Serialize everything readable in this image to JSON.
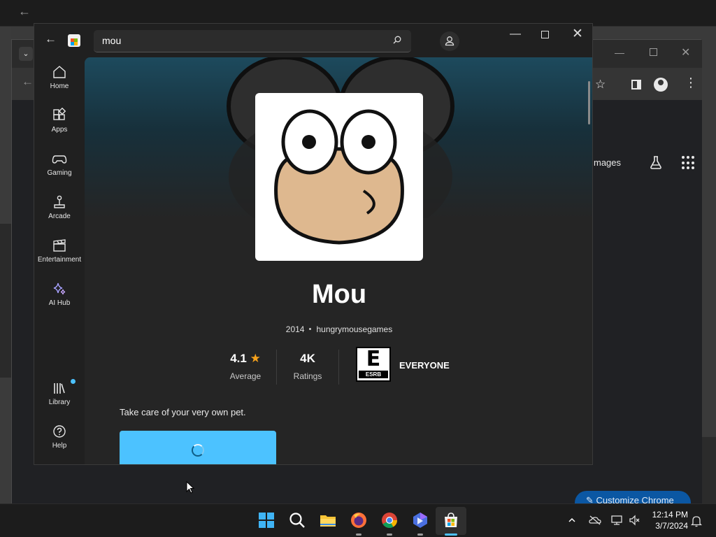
{
  "store": {
    "search": {
      "value": "mou"
    },
    "nav": [
      {
        "label": "Home"
      },
      {
        "label": "Apps"
      },
      {
        "label": "Gaming"
      },
      {
        "label": "Arcade"
      },
      {
        "label": "Entertainment"
      },
      {
        "label": "AI Hub"
      },
      {
        "label": "Library"
      },
      {
        "label": "Help"
      }
    ],
    "app": {
      "title": "Mou",
      "year": "2014",
      "developer": "hungrymousegames",
      "rating": "4.1",
      "rating_label": "Average",
      "ratings_count": "4K",
      "ratings_label": "Ratings",
      "esrb": "EVERYONE",
      "esrb_badge_letter": "E",
      "esrb_badge_text": "ESRB",
      "description": "Take care of your very own pet."
    },
    "colors": {
      "accent": "#4cc2ff",
      "star": "#f7a21b"
    }
  },
  "chrome": {
    "images_label": "mages",
    "customize_label": "Customize Chrome"
  },
  "taskbar": {
    "time": "12:14 PM",
    "date": "3/7/2024",
    "pinned": [
      "start-icon",
      "search-icon",
      "file-explorer-icon",
      "firefox-icon",
      "chrome-icon",
      "bing-icon",
      "store-icon"
    ]
  }
}
